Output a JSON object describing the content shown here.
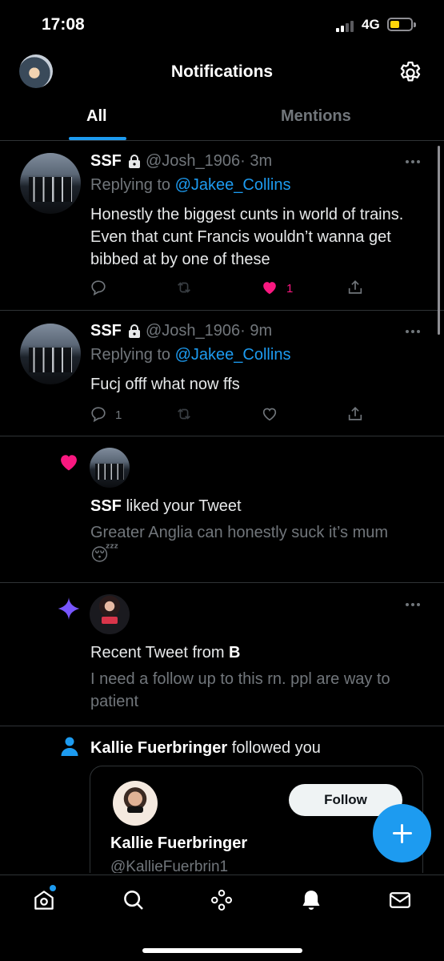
{
  "status_bar": {
    "time": "17:08",
    "network": "4G"
  },
  "header": {
    "title": "Notifications"
  },
  "tabs": [
    {
      "label": "All",
      "active": true
    },
    {
      "label": "Mentions",
      "active": false
    }
  ],
  "tweets": [
    {
      "name": "SSF",
      "handle": "@Josh_1906",
      "time": "· 3m",
      "replying_prefix": "Replying to ",
      "replying_to": "@Jakee_Collins",
      "text": "Honestly the biggest cunts in world of trains. Even that cunt Francis wouldn’t wanna get bibbed at by one of these",
      "reply_count": "",
      "like_count": "1",
      "liked": true
    },
    {
      "name": "SSF",
      "handle": "@Josh_1906",
      "time": "· 9m",
      "replying_prefix": "Replying to ",
      "replying_to": "@Jakee_Collins",
      "text": "Fucj offf what now ffs",
      "reply_count": "1",
      "like_count": "",
      "liked": false
    }
  ],
  "like_notification": {
    "actor": "SSF",
    "action": " liked your Tweet",
    "tweet_text": "Greater Anglia can honestly suck it’s mum",
    "emoji": "😴"
  },
  "recent_tweet": {
    "prefix": "Recent Tweet from ",
    "author": "B",
    "text": "I need a follow up to this rn. ppl are way to patient"
  },
  "follow_notification": {
    "actor": "Kallie Fuerbringer",
    "action": " followed you",
    "card_name": "Kallie Fuerbringer",
    "card_handle": "@KallieFuerbrin1",
    "button_label": "Follow"
  },
  "colors": {
    "accent": "#1d9bf0",
    "like": "#f91880",
    "spark": "#7856ff",
    "background": "#000000"
  },
  "nav": [
    "home-icon",
    "search-icon",
    "spaces-icon",
    "notifications-icon",
    "messages-icon"
  ]
}
